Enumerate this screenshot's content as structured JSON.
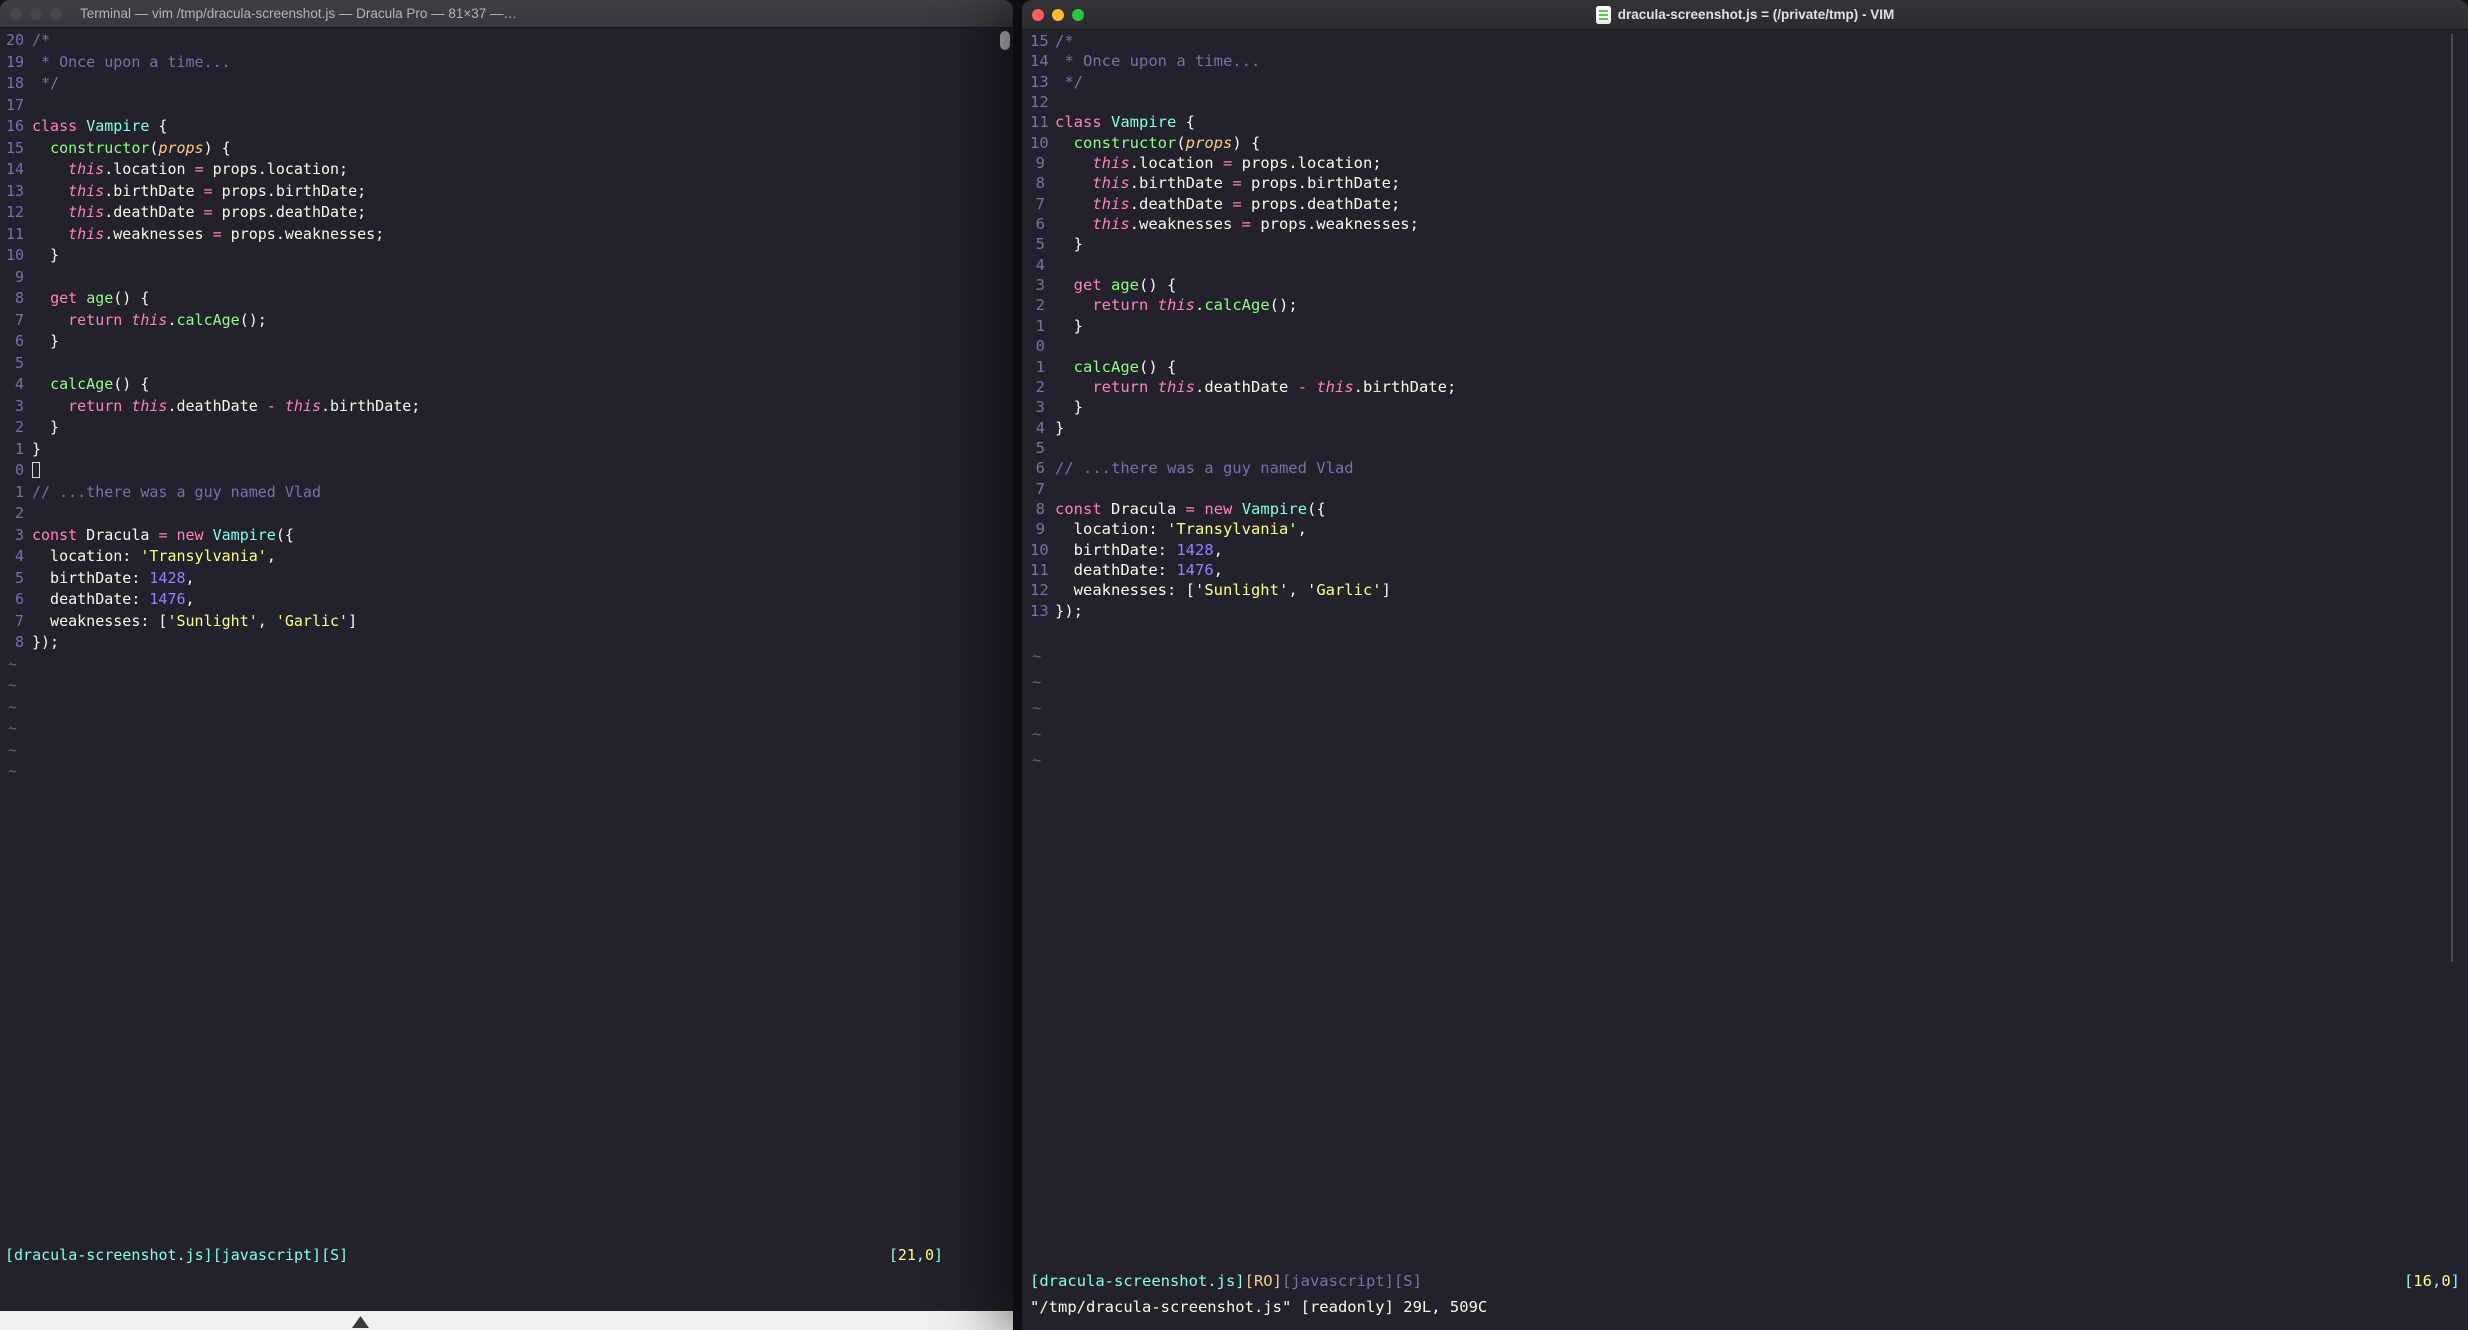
{
  "colors": {
    "background": "#22212c",
    "foreground": "#f8f8f2",
    "comment": "#7970a9",
    "pink": "#ff80bf",
    "green": "#8aff80",
    "cyan": "#80ffea",
    "purple": "#9580ff",
    "yellow": "#ffff80",
    "orange": "#ffca80"
  },
  "left_window": {
    "title": "Terminal — vim /tmp/dracula-screenshot.js — Dracula Pro — 81×37 —…",
    "cursor_line_index": 20,
    "cursor": "hollow",
    "tilde_count": 6,
    "status_segments": [
      {
        "t": "[dracula-screenshot.js]",
        "c": "cyan"
      },
      {
        "t": "[javascript]",
        "c": "cyan"
      },
      {
        "t": "[S]",
        "c": "cyan"
      }
    ],
    "ruler": [
      {
        "t": "[",
        "c": "cyan"
      },
      {
        "t": "21",
        "c": "yellow"
      },
      {
        "t": ",",
        "c": "cyan"
      },
      {
        "t": "0",
        "c": "yellow"
      },
      {
        "t": "]",
        "c": "cyan"
      }
    ]
  },
  "right_window": {
    "title": "dracula-screenshot.js = (/private/tmp) - VIM",
    "cursor_line_index": 15,
    "cursor": "none",
    "tilde_count": 5,
    "status_segments": [
      {
        "t": "[dracula-screenshot.js]",
        "c": "cyan"
      },
      {
        "t": "[RO]",
        "c": "orange"
      },
      {
        "t": "[javascript]",
        "c": "comment"
      },
      {
        "t": "[S]",
        "c": "comment"
      }
    ],
    "ruler": [
      {
        "t": "[",
        "c": "cyan"
      },
      {
        "t": "16",
        "c": "yellow"
      },
      {
        "t": ",",
        "c": "cyan"
      },
      {
        "t": "0",
        "c": "yellow"
      },
      {
        "t": "]",
        "c": "cyan"
      }
    ],
    "message_line": "\"/tmp/dracula-screenshot.js\" [readonly] 29L, 509C"
  },
  "code_lines": [
    [
      {
        "t": "/*",
        "c": "comment"
      }
    ],
    [
      {
        "t": " * Once upon a time...",
        "c": "comment"
      }
    ],
    [
      {
        "t": " */",
        "c": "comment"
      }
    ],
    [],
    [
      {
        "t": "class",
        "c": "pink"
      },
      {
        "t": " ",
        "c": "foreground"
      },
      {
        "t": "Vampire",
        "c": "cyan"
      },
      {
        "t": " {",
        "c": "foreground"
      }
    ],
    [
      {
        "t": "  ",
        "c": "foreground"
      },
      {
        "t": "constructor",
        "c": "green"
      },
      {
        "t": "(",
        "c": "foreground"
      },
      {
        "t": "props",
        "c": "orange",
        "i": true
      },
      {
        "t": ") {",
        "c": "foreground"
      }
    ],
    [
      {
        "t": "    ",
        "c": "foreground"
      },
      {
        "t": "this",
        "c": "pink",
        "i": true
      },
      {
        "t": ".location ",
        "c": "foreground"
      },
      {
        "t": "=",
        "c": "pink"
      },
      {
        "t": " props.location;",
        "c": "foreground"
      }
    ],
    [
      {
        "t": "    ",
        "c": "foreground"
      },
      {
        "t": "this",
        "c": "pink",
        "i": true
      },
      {
        "t": ".birthDate ",
        "c": "foreground"
      },
      {
        "t": "=",
        "c": "pink"
      },
      {
        "t": " props.birthDate;",
        "c": "foreground"
      }
    ],
    [
      {
        "t": "    ",
        "c": "foreground"
      },
      {
        "t": "this",
        "c": "pink",
        "i": true
      },
      {
        "t": ".deathDate ",
        "c": "foreground"
      },
      {
        "t": "=",
        "c": "pink"
      },
      {
        "t": " props.deathDate;",
        "c": "foreground"
      }
    ],
    [
      {
        "t": "    ",
        "c": "foreground"
      },
      {
        "t": "this",
        "c": "pink",
        "i": true
      },
      {
        "t": ".weaknesses ",
        "c": "foreground"
      },
      {
        "t": "=",
        "c": "pink"
      },
      {
        "t": " props.weaknesses;",
        "c": "foreground"
      }
    ],
    [
      {
        "t": "  }",
        "c": "foreground"
      }
    ],
    [],
    [
      {
        "t": "  ",
        "c": "foreground"
      },
      {
        "t": "get",
        "c": "pink"
      },
      {
        "t": " ",
        "c": "foreground"
      },
      {
        "t": "age",
        "c": "green"
      },
      {
        "t": "() {",
        "c": "foreground"
      }
    ],
    [
      {
        "t": "    ",
        "c": "foreground"
      },
      {
        "t": "return",
        "c": "pink"
      },
      {
        "t": " ",
        "c": "foreground"
      },
      {
        "t": "this",
        "c": "pink",
        "i": true
      },
      {
        "t": ".",
        "c": "foreground"
      },
      {
        "t": "calcAge",
        "c": "green"
      },
      {
        "t": "();",
        "c": "foreground"
      }
    ],
    [
      {
        "t": "  }",
        "c": "foreground"
      }
    ],
    [],
    [
      {
        "t": "  ",
        "c": "foreground"
      },
      {
        "t": "calcAge",
        "c": "green"
      },
      {
        "t": "() {",
        "c": "foreground"
      }
    ],
    [
      {
        "t": "    ",
        "c": "foreground"
      },
      {
        "t": "return",
        "c": "pink"
      },
      {
        "t": " ",
        "c": "foreground"
      },
      {
        "t": "this",
        "c": "pink",
        "i": true
      },
      {
        "t": ".deathDate ",
        "c": "foreground"
      },
      {
        "t": "-",
        "c": "pink"
      },
      {
        "t": " ",
        "c": "foreground"
      },
      {
        "t": "this",
        "c": "pink",
        "i": true
      },
      {
        "t": ".birthDate;",
        "c": "foreground"
      }
    ],
    [
      {
        "t": "  }",
        "c": "foreground"
      }
    ],
    [
      {
        "t": "}",
        "c": "foreground"
      }
    ],
    [],
    [
      {
        "t": "// ...there was a guy named Vlad",
        "c": "comment"
      }
    ],
    [],
    [
      {
        "t": "const",
        "c": "pink"
      },
      {
        "t": " Dracula ",
        "c": "foreground"
      },
      {
        "t": "=",
        "c": "pink"
      },
      {
        "t": " ",
        "c": "foreground"
      },
      {
        "t": "new",
        "c": "pink"
      },
      {
        "t": " ",
        "c": "foreground"
      },
      {
        "t": "Vampire",
        "c": "cyan"
      },
      {
        "t": "({",
        "c": "foreground"
      }
    ],
    [
      {
        "t": "  location: ",
        "c": "foreground"
      },
      {
        "t": "'Transylvania'",
        "c": "yellow"
      },
      {
        "t": ",",
        "c": "foreground"
      }
    ],
    [
      {
        "t": "  birthDate: ",
        "c": "foreground"
      },
      {
        "t": "1428",
        "c": "purple"
      },
      {
        "t": ",",
        "c": "foreground"
      }
    ],
    [
      {
        "t": "  deathDate: ",
        "c": "foreground"
      },
      {
        "t": "1476",
        "c": "purple"
      },
      {
        "t": ",",
        "c": "foreground"
      }
    ],
    [
      {
        "t": "  weaknesses: [",
        "c": "foreground"
      },
      {
        "t": "'Sunlight'",
        "c": "yellow"
      },
      {
        "t": ", ",
        "c": "foreground"
      },
      {
        "t": "'Garlic'",
        "c": "yellow"
      },
      {
        "t": "]",
        "c": "foreground"
      }
    ],
    [
      {
        "t": "});",
        "c": "foreground"
      }
    ]
  ]
}
